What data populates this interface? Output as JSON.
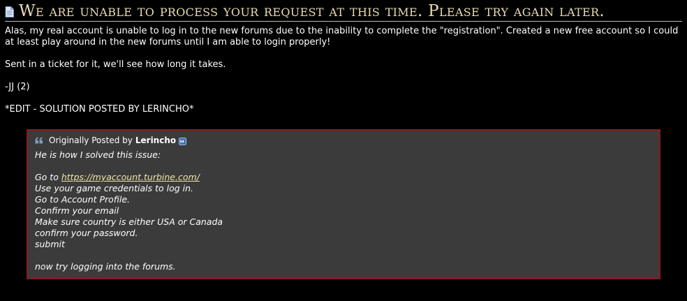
{
  "post": {
    "title": "We are unable to process your request at this time. Please try again later.",
    "paragraphs": [
      "Alas, my real account is unable to log in to the new forums due to the inability to complete the \"registration\". Created a new free account so I could at least play around in the new forums until I am able to login properly!",
      "Sent in a ticket for it, we'll see how long it takes.",
      "-JJ (2)",
      "*EDIT - SOLUTION POSTED BY LERINCHO*"
    ],
    "title_color": "#e9dcb0"
  },
  "quote": {
    "prefix": "Originally Posted by",
    "author": "Lerincho",
    "intro": "He is how I solved this issue:",
    "goto_prefix": "Go to",
    "link": "https://myaccount.turbine.com/",
    "steps": [
      "Use your game credentials to log in.",
      "Go to Account Profile.",
      "Confirm your email",
      "Make sure country is either USA or Canada",
      "confirm your password.",
      "submit"
    ],
    "outro": "now try logging into the forums.",
    "border_color": "#8b1a1a",
    "background": "#3b3b3b",
    "link_color": "#f1e2a8"
  },
  "icons": {
    "title": "document-icon",
    "quote": "quote-marks-icon",
    "view_post": "view-post-arrow-icon"
  }
}
